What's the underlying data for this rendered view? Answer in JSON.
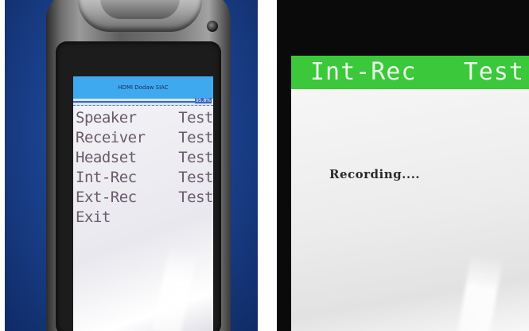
{
  "left_phone": {
    "header_title": "HDMI Dodaw SIAC",
    "progress_label": "95.8%",
    "progress_fraction": 0.9,
    "menu": [
      {
        "label": "Speaker",
        "action": "Test"
      },
      {
        "label": "Receiver",
        "action": "Test"
      },
      {
        "label": "Headset",
        "action": "Test"
      },
      {
        "label": "Int-Rec",
        "action": "Test"
      },
      {
        "label": "Ext-Rec",
        "action": "Test"
      },
      {
        "label": "Exit",
        "action": ""
      }
    ]
  },
  "right_screen": {
    "title_left": "Int-Rec",
    "title_right": "Test",
    "status": "Recording...."
  },
  "colors": {
    "left_background": "#1a3f8a",
    "left_header": "#3fa9f0",
    "right_header": "#3bc83b",
    "right_background": "#0a0a0a"
  }
}
